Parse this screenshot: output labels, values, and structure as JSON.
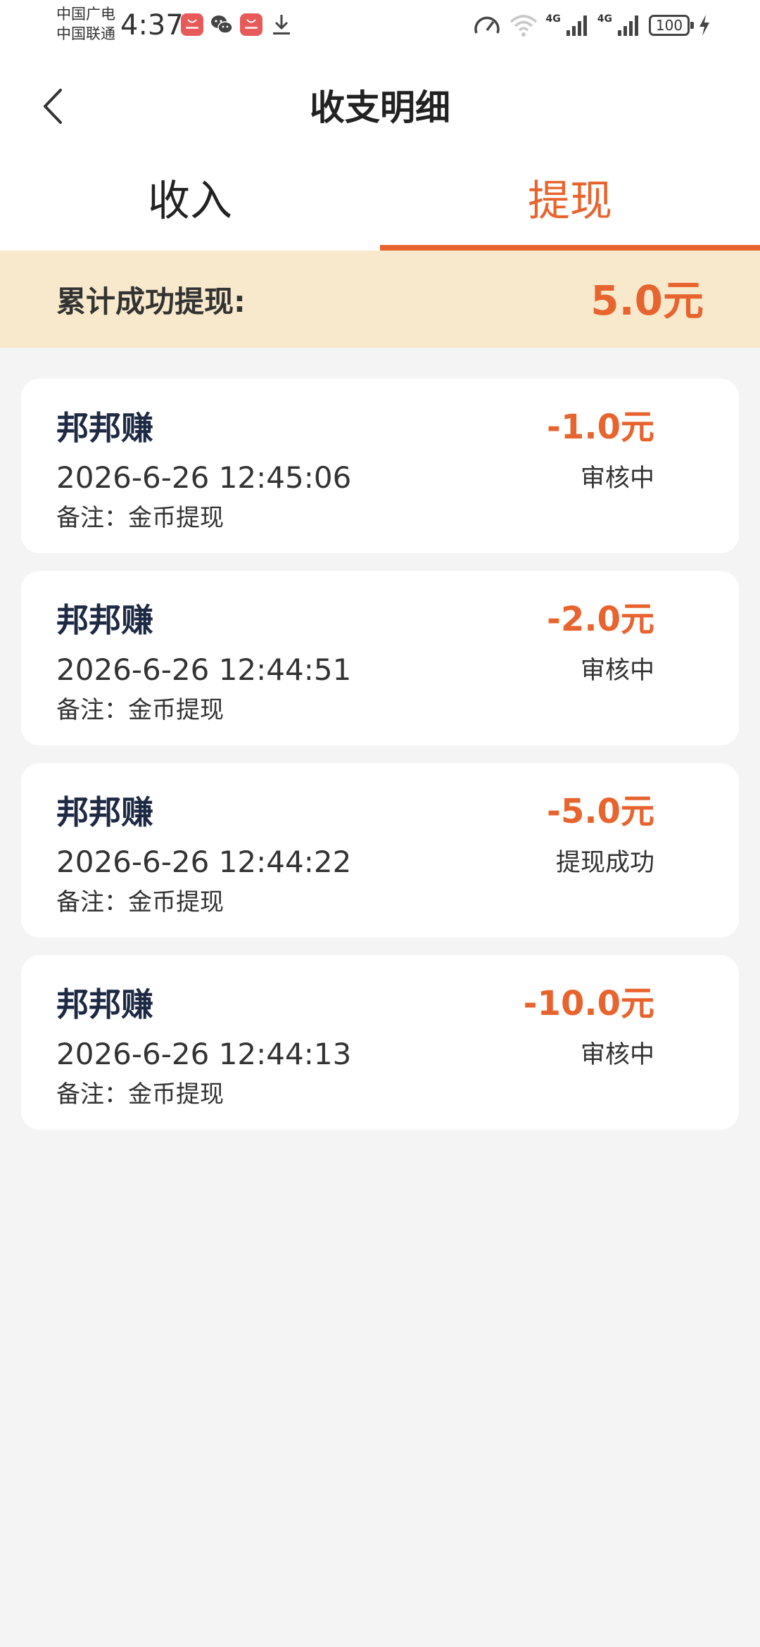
{
  "status_bar": {
    "carrier_1": "中国广电",
    "carrier_2": "中国联通",
    "time": "4:37",
    "network_1": "4G",
    "network_2": "4G",
    "battery": "100"
  },
  "header": {
    "title": "收支明细"
  },
  "tabs": [
    {
      "label": "收入",
      "active": false
    },
    {
      "label": "提现",
      "active": true
    }
  ],
  "summary": {
    "label": "累计成功提现:",
    "value": "5.0元"
  },
  "records": [
    {
      "name": "邦邦赚",
      "time": "2026-6-26 12:45:06",
      "note": "备注：金币提现",
      "amount": "-1.0元",
      "status": "审核中"
    },
    {
      "name": "邦邦赚",
      "time": "2026-6-26 12:44:51",
      "note": "备注：金币提现",
      "amount": "-2.0元",
      "status": "审核中"
    },
    {
      "name": "邦邦赚",
      "time": "2026-6-26 12:44:22",
      "note": "备注：金币提现",
      "amount": "-5.0元",
      "status": "提现成功"
    },
    {
      "name": "邦邦赚",
      "time": "2026-6-26 12:44:13",
      "note": "备注：金币提现",
      "amount": "-10.0元",
      "status": "审核中"
    }
  ],
  "colors": {
    "accent": "#e8642e",
    "summary_background": "#f8e9cd",
    "page_background": "#f4f4f4",
    "record_name": "#1e2a44"
  },
  "icons": {
    "back": "chevron-left-icon",
    "notifications": [
      "huawei-appgallery-icon",
      "wechat-icon",
      "huawei-appgallery-icon",
      "download-icon"
    ],
    "status": [
      "speed-meter-icon",
      "wifi-icon",
      "signal-icon",
      "signal-icon",
      "battery-icon",
      "charging-icon"
    ]
  }
}
